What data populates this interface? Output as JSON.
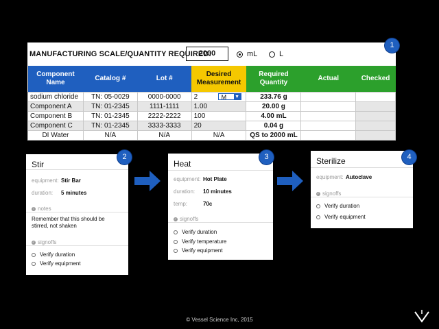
{
  "scale": {
    "label": "MANUFACTURING SCALE/QUANTITY REQUIRED:",
    "value": "2000",
    "unit_ml": "mL",
    "unit_l": "L",
    "selected_unit": "mL"
  },
  "table": {
    "headers": {
      "component": "Component Name",
      "catalog": "Catalog #",
      "lot": "Lot #",
      "desired": "Desired Measurement",
      "required": "Required Quantity",
      "actual": "Actual",
      "checked": "Checked"
    },
    "rows": [
      {
        "name": "sodium chloride",
        "catalog": "TN: 05-0029",
        "lot": "0000-0000",
        "desired": "2",
        "unit": "M",
        "required": "233.76 g"
      },
      {
        "name": "Component A",
        "catalog": "TN: 01-2345",
        "lot": "1111-1111",
        "desired": "1.00",
        "unit": "",
        "required": "20.00 g"
      },
      {
        "name": "Component B",
        "catalog": "TN: 01-2345",
        "lot": "2222-2222",
        "desired": "100",
        "unit": "",
        "required": "4.00 mL"
      },
      {
        "name": "Component C",
        "catalog": "TN: 01-2345",
        "lot": "3333-3333",
        "desired": "20",
        "unit": "",
        "required": "0.04 g"
      },
      {
        "name": "DI Water",
        "catalog": "N/A",
        "lot": "N/A",
        "desired": "N/A",
        "unit": "",
        "required": "QS to 2000 mL"
      }
    ]
  },
  "badges": [
    "1",
    "2",
    "3",
    "4"
  ],
  "steps": {
    "stir": {
      "title": "Stir",
      "equipment_label": "equipment:",
      "equipment": "Stir Bar",
      "duration_label": "duration:",
      "duration": "5 minutes",
      "notes_label": "notes",
      "note": "Remember that this should be stirred, not shaken",
      "signoffs_label": "signoffs",
      "signoffs": [
        "Verify duration",
        "Verify equipment"
      ]
    },
    "heat": {
      "title": "Heat",
      "equipment_label": "equipment:",
      "equipment": "Hot Plate",
      "duration_label": "duration:",
      "duration": "10 minutes",
      "temp_label": "temp:",
      "temp": "70c",
      "signoffs_label": "signoffs",
      "signoffs": [
        "Verify duration",
        "Verify temperature",
        "Verify equipment"
      ]
    },
    "sterilize": {
      "title": "Sterilize",
      "equipment_label": "equipment:",
      "equipment": "Autoclave",
      "signoffs_label": "signoffs",
      "signoffs": [
        "Verify duration",
        "Verify equipment"
      ]
    }
  },
  "footer": "© Vessel Science Inc, 2015",
  "colors": {
    "blue": "#1f5fbf",
    "yellow": "#f5c800",
    "green": "#2ca02c"
  },
  "icons": {
    "arrow": "arrow-right-icon",
    "logo": "vessel-logo-icon"
  }
}
